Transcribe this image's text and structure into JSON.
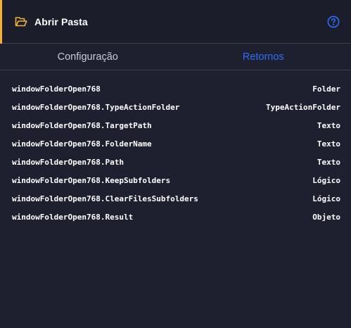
{
  "colors": {
    "accent": "#f2b134",
    "active_tab": "#2f6df6",
    "help": "#2f6df6",
    "background": "#1e2030"
  },
  "header": {
    "icon": "folder-open-icon",
    "title": "Abrir Pasta",
    "help_icon": "help-circle-icon"
  },
  "tabs": [
    {
      "label": "Configuração",
      "active": false
    },
    {
      "label": "Retornos",
      "active": true
    }
  ],
  "returns": [
    {
      "name": "windowFolderOpen768",
      "type": "Folder"
    },
    {
      "name": "windowFolderOpen768.TypeActionFolder",
      "type": "TypeActionFolder"
    },
    {
      "name": "windowFolderOpen768.TargetPath",
      "type": "Texto"
    },
    {
      "name": "windowFolderOpen768.FolderName",
      "type": "Texto"
    },
    {
      "name": "windowFolderOpen768.Path",
      "type": "Texto"
    },
    {
      "name": "windowFolderOpen768.KeepSubfolders",
      "type": "Lógico"
    },
    {
      "name": "windowFolderOpen768.ClearFilesSubfolders",
      "type": "Lógico"
    },
    {
      "name": "windowFolderOpen768.Result",
      "type": "Objeto"
    }
  ]
}
